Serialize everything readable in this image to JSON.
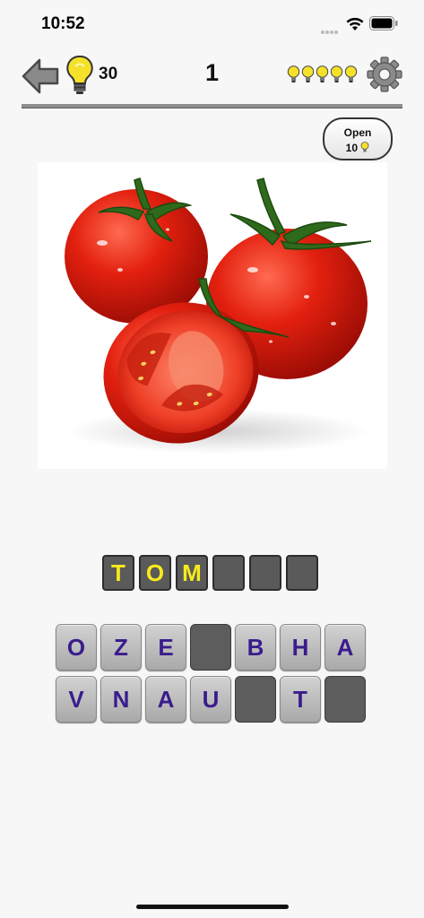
{
  "status_bar": {
    "time": "10:52"
  },
  "toolbar": {
    "hint_count": "30",
    "level": "1",
    "mini_bulbs": 5
  },
  "open_button": {
    "label": "Open",
    "cost": "10"
  },
  "answer": {
    "slots": [
      "T",
      "O",
      "M",
      "",
      "",
      ""
    ]
  },
  "keyboard": {
    "row1": [
      "O",
      "Z",
      "E",
      "",
      "B",
      "H",
      "A"
    ],
    "row2": [
      "V",
      "N",
      "A",
      "U",
      "",
      "T",
      ""
    ]
  },
  "colors": {
    "answer_letter": "#f7ea1c",
    "key_letter": "#3a1c8c",
    "bulb": "#f5e12a"
  }
}
